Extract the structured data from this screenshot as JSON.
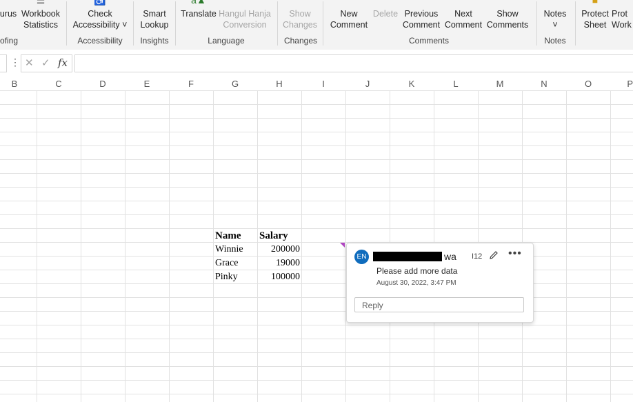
{
  "ribbon": {
    "buttons": {
      "thesaurus": "urus",
      "workbook_stats_1": "Workbook",
      "workbook_stats_2": "Statistics",
      "check_access_1": "Check",
      "check_access_2": "Accessibility ˅",
      "smart_lookup_1": "Smart",
      "smart_lookup_2": "Lookup",
      "translate": "Translate",
      "hangul_1": "Hangul Hanja",
      "hangul_2": "Conversion",
      "show_changes_1": "Show",
      "show_changes_2": "Changes",
      "new_comment_1": "New",
      "new_comment_2": "Comment",
      "delete": "Delete",
      "prev_comment_1": "Previous",
      "prev_comment_2": "Comment",
      "next_comment_1": "Next",
      "next_comment_2": "Comment",
      "show_comments_1": "Show",
      "show_comments_2": "Comments",
      "notes_1": "Notes",
      "notes_2": "˅",
      "protect_sheet_1": "Protect",
      "protect_sheet_2": "Sheet",
      "protect_wb_1": "Prot",
      "protect_wb_2": "Work"
    },
    "groups": {
      "proofing": "ofing",
      "accessibility": "Accessibility",
      "insights": "Insights",
      "language": "Language",
      "changes": "Changes",
      "comments": "Comments",
      "notes": "Notes"
    }
  },
  "formula_bar": {
    "dots": "⋮",
    "cancel": "✕",
    "enter": "✓",
    "fx": "fx",
    "value": ""
  },
  "columns": [
    "B",
    "C",
    "D",
    "E",
    "F",
    "G",
    "H",
    "I",
    "J",
    "K",
    "L",
    "M",
    "N",
    "O",
    "P"
  ],
  "table": {
    "header_name": "Name",
    "header_salary": "Salary",
    "rows": [
      {
        "name": "Winnie",
        "salary": "200000"
      },
      {
        "name": "Grace",
        "salary": "19000"
      },
      {
        "name": "Pinky",
        "salary": "100000"
      }
    ]
  },
  "comment": {
    "initials": "EN",
    "author_suffix": "wa",
    "cell_ref": "I12",
    "text": "Please add more data",
    "date": "August 30, 2022, 3:47 PM",
    "reply_placeholder": "Reply",
    "more": "•••"
  },
  "colors": {
    "ribbon_bg": "#f3f3f3",
    "avatar": "#0f6cbd",
    "comment_indicator": "#b146c2"
  }
}
